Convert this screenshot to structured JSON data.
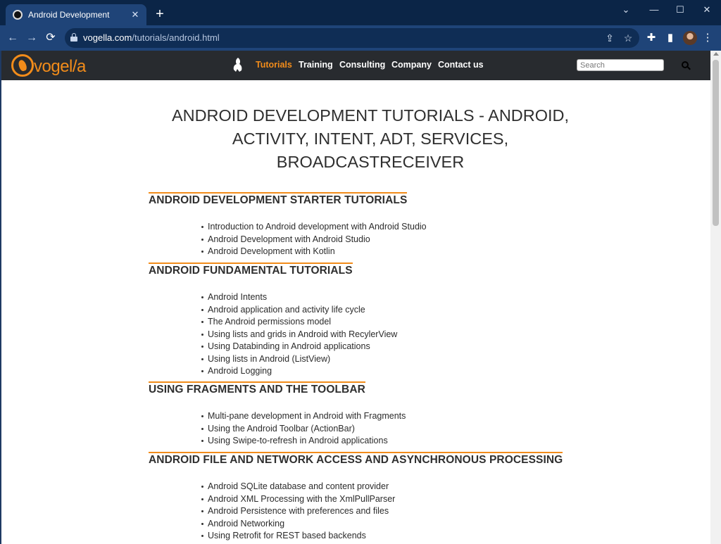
{
  "browser": {
    "tab": {
      "title": "Android Development",
      "close_glyph": "✕"
    },
    "new_tab_glyph": "+",
    "window_controls": {
      "minimize": "—",
      "maximize": "☐",
      "close": "✕",
      "menu": "⌄"
    },
    "nav": {
      "back": "←",
      "forward": "→",
      "reload": "⟳"
    },
    "url": {
      "host": "vogella.com",
      "path": "/tutorials/android.html"
    },
    "omnibox_icons": {
      "share": "⇪",
      "bookmark": "☆"
    },
    "toolbar_icons": {
      "extensions": "✚",
      "side_panel": "▮",
      "menu": "⋮"
    }
  },
  "site": {
    "logo_text": "vogel/a",
    "nav": [
      "Tutorials",
      "Training",
      "Consulting",
      "Company",
      "Contact us"
    ],
    "active_nav": "Tutorials",
    "search_placeholder": "Search",
    "accent_color": "#f28c1a",
    "header_bg": "#282b2f"
  },
  "page": {
    "title": "ANDROID DEVELOPMENT TUTORIALS - ANDROID, ACTIVITY, INTENT, ADT, SERVICES, BROADCASTRECEIVER",
    "sections": [
      {
        "title": "ANDROID DEVELOPMENT STARTER TUTORIALS",
        "items": [
          "Introduction to Android development with Android Studio",
          "Android Development with Android Studio",
          "Android Development with Kotlin"
        ]
      },
      {
        "title": "ANDROID FUNDAMENTAL TUTORIALS",
        "items": [
          "Android Intents",
          "Android application and activity life cycle",
          "The Android permissions model",
          "Using lists and grids in Android with RecylerView",
          "Using Databinding in Android applications",
          "Using lists in Android (ListView)",
          "Android Logging"
        ]
      },
      {
        "title": "USING FRAGMENTS AND THE TOOLBAR",
        "items": [
          "Multi-pane development in Android with Fragments",
          "Using the Android Toolbar (ActionBar)",
          "Using Swipe-to-refresh in Android applications"
        ]
      },
      {
        "title": "ANDROID FILE AND NETWORK ACCESS AND ASYNCHRONOUS PROCESSING",
        "items": [
          "Android SQLite database and content provider",
          "Android XML Processing with the XmlPullParser",
          "Android Persistence with preferences and files",
          "Android Networking",
          "Using Retrofit for REST based backends"
        ]
      }
    ]
  }
}
